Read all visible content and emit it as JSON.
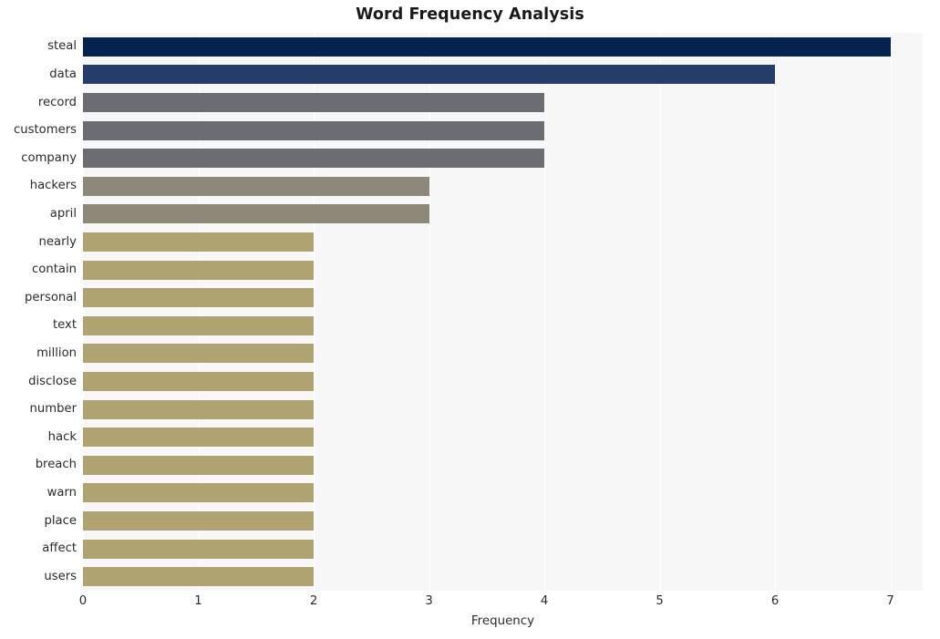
{
  "chart_data": {
    "type": "bar",
    "orientation": "horizontal",
    "title": "Word Frequency Analysis",
    "xlabel": "Frequency",
    "ylabel": "",
    "xlim": [
      0,
      7.28
    ],
    "xticks": [
      "0",
      "1",
      "2",
      "3",
      "4",
      "5",
      "6",
      "7"
    ],
    "xtick_values": [
      0,
      1,
      2,
      3,
      4,
      5,
      6,
      7
    ],
    "grid": "vertical-white-on-light-gray",
    "legend": "none",
    "categories": [
      "steal",
      "data",
      "record",
      "customers",
      "company",
      "hackers",
      "april",
      "nearly",
      "contain",
      "personal",
      "text",
      "million",
      "disclose",
      "number",
      "hack",
      "breach",
      "warn",
      "place",
      "affect",
      "users"
    ],
    "values": [
      7,
      6,
      4,
      4,
      4,
      3,
      3,
      2,
      2,
      2,
      2,
      2,
      2,
      2,
      2,
      2,
      2,
      2,
      2,
      2
    ],
    "bar_colors": [
      "#04234f",
      "#263d6b",
      "#6b6d73",
      "#6b6d73",
      "#6b6d73",
      "#8e8878",
      "#8e8878",
      "#afa371",
      "#afa371",
      "#afa371",
      "#afa371",
      "#afa371",
      "#afa371",
      "#afa371",
      "#afa371",
      "#afa371",
      "#afa371",
      "#afa371",
      "#afa371",
      "#afa371"
    ],
    "plot_background": "#f7f7f7",
    "figure_background": "#ffffff",
    "gridline_color": "#ffffff",
    "text_color": "#2b2b2b",
    "title_color": "#1a1a1a"
  }
}
